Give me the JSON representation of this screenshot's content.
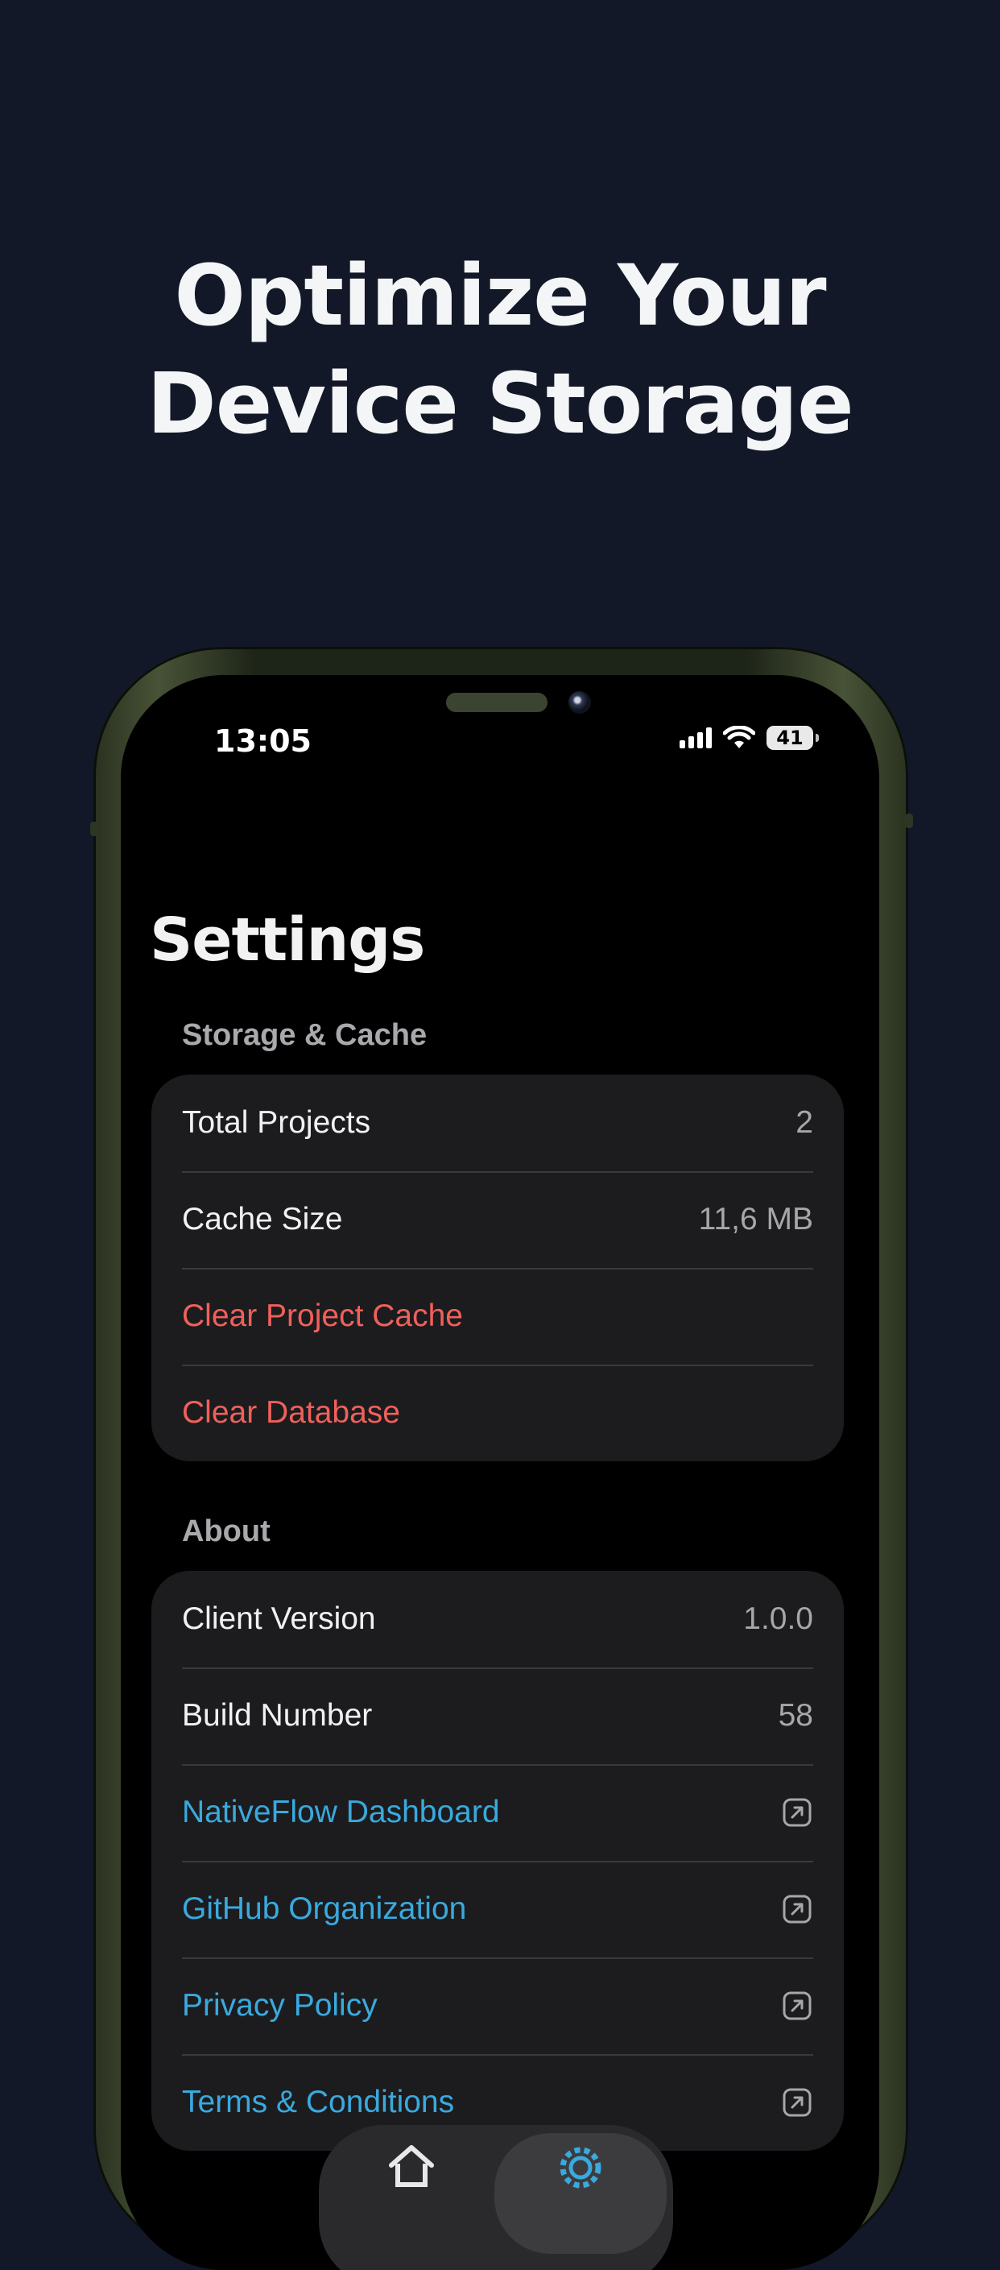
{
  "promo": {
    "headline_line1": "Optimize Your",
    "headline_line2": "Device Storage"
  },
  "status_bar": {
    "time": "13:05",
    "battery": "41",
    "icons": [
      "signal-icon",
      "wifi-icon",
      "battery-icon"
    ]
  },
  "settings": {
    "title": "Settings",
    "sections": [
      {
        "header": "Storage & Cache",
        "rows": [
          {
            "label": "Total Projects",
            "value": "2"
          },
          {
            "label": "Cache Size",
            "value": "11,6 MB"
          },
          {
            "label": "Clear Project Cache"
          },
          {
            "label": "Clear Database"
          }
        ]
      },
      {
        "header": "About",
        "rows": [
          {
            "label": "Client Version",
            "value": "1.0.0"
          },
          {
            "label": "Build Number",
            "value": "58"
          },
          {
            "label": "NativeFlow Dashboard",
            "icon": "external-link-icon"
          },
          {
            "label": "GitHub Organization",
            "icon": "external-link-icon"
          },
          {
            "label": "Privacy Policy",
            "icon": "external-link-icon"
          },
          {
            "label": "Terms & Conditions",
            "icon": "external-link-icon"
          }
        ]
      }
    ]
  },
  "tabbar": {
    "tabs": [
      {
        "icon": "home-icon",
        "active": false
      },
      {
        "icon": "gear-icon",
        "active": true
      }
    ]
  },
  "colors": {
    "page_background": "#121827",
    "danger": "#f0605b",
    "link": "#3aa9de",
    "cell_background": "#1c1c1e"
  }
}
